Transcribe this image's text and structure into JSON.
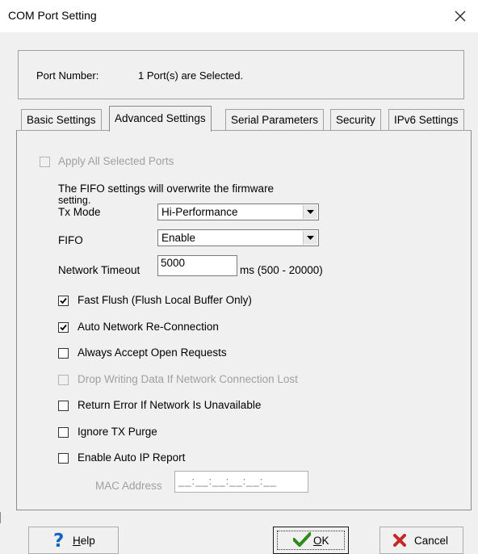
{
  "window": {
    "title": "COM Port Setting",
    "close_glyph": "✕"
  },
  "port": {
    "label": "Port Number:",
    "value": "1 Port(s) are Selected."
  },
  "tabs": [
    {
      "label": "Basic Settings",
      "active": false
    },
    {
      "label": "Advanced Settings",
      "active": true
    },
    {
      "label": "Serial Parameters",
      "active": false
    },
    {
      "label": "Security",
      "active": false
    },
    {
      "label": "IPv6 Settings",
      "active": false
    }
  ],
  "advanced": {
    "apply_all": {
      "label": "Apply All Selected Ports",
      "checked": false,
      "enabled": false
    },
    "fifo_note_line1": "The FIFO settings will overwrite the firmware",
    "fifo_note_line2": "setting.",
    "tx_mode": {
      "label": "Tx Mode",
      "value": "Hi-Performance"
    },
    "fifo": {
      "label": "FIFO",
      "value": "Enable"
    },
    "network_timeout": {
      "label": "Network Timeout",
      "value": "5000",
      "range": "ms (500 - 20000)"
    },
    "options": [
      {
        "label": "Fast Flush (Flush Local Buffer Only)",
        "checked": true,
        "enabled": true
      },
      {
        "label": "Auto Network Re-Connection",
        "checked": true,
        "enabled": true
      },
      {
        "label": "Always Accept Open Requests",
        "checked": false,
        "enabled": true
      },
      {
        "label": "Drop Writing Data If Network Connection Lost",
        "checked": false,
        "enabled": false
      },
      {
        "label": "Return Error If Network Is Unavailable",
        "checked": false,
        "enabled": true
      },
      {
        "label": "Ignore TX Purge",
        "checked": false,
        "enabled": true
      },
      {
        "label": "Enable Auto IP Report",
        "checked": false,
        "enabled": true
      }
    ],
    "mac_address": {
      "label": "MAC Address",
      "mask": "__:__:__:__:__:__"
    }
  },
  "buttons": {
    "help": {
      "label": "Help",
      "icon": "help-question-icon"
    },
    "ok": {
      "label": "OK",
      "icon": "checkmark-icon"
    },
    "cancel": {
      "label": "Cancel",
      "icon": "red-x-icon"
    }
  },
  "colors": {
    "help_icon": "#1565c0",
    "ok_icon": "#2e8b1a",
    "cancel_icon": "#c62828",
    "disabled_text": "#a0a0a0"
  }
}
